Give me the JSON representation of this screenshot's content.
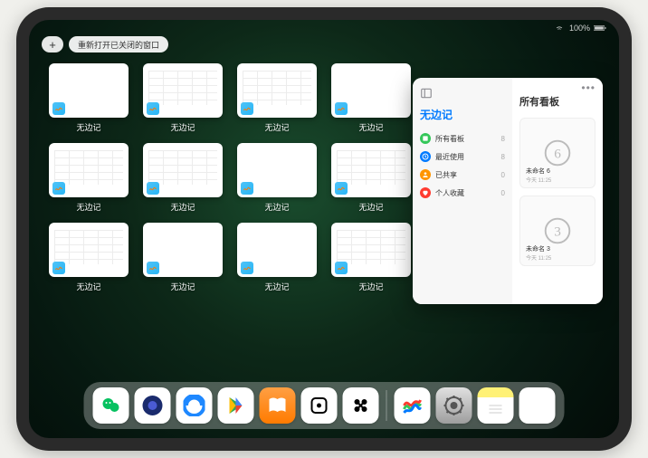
{
  "status": {
    "battery_text": "100%"
  },
  "top": {
    "plus_label": "+",
    "reopen_label": "重新打开已关闭的窗口"
  },
  "windows": [
    {
      "label": "无边记",
      "thumb": "blank"
    },
    {
      "label": "无边记",
      "thumb": "grid"
    },
    {
      "label": "无边记",
      "thumb": "grid"
    },
    {
      "label": "无边记",
      "thumb": "blank"
    },
    {
      "label": "无边记",
      "thumb": "grid"
    },
    {
      "label": "无边记",
      "thumb": "grid"
    },
    {
      "label": "无边记",
      "thumb": "blank"
    },
    {
      "label": "无边记",
      "thumb": "grid"
    },
    {
      "label": "无边记",
      "thumb": "grid"
    },
    {
      "label": "无边记",
      "thumb": "blank"
    },
    {
      "label": "无边记",
      "thumb": "blank"
    },
    {
      "label": "无边记",
      "thumb": "grid"
    }
  ],
  "expanded": {
    "sidebar_title": "无边记",
    "main_title": "所有看板",
    "items": [
      {
        "icon": "square-stack",
        "color": "#34c759",
        "label": "所有看板",
        "count": "8"
      },
      {
        "icon": "clock",
        "color": "#007aff",
        "label": "最近使用",
        "count": "8"
      },
      {
        "icon": "person",
        "color": "#ff9500",
        "label": "已共享",
        "count": "0"
      },
      {
        "icon": "heart",
        "color": "#ff3b30",
        "label": "个人收藏",
        "count": "0"
      }
    ],
    "boards": [
      {
        "name": "未命名 6",
        "time": "今天 11:25",
        "sketch": "6"
      },
      {
        "name": "未命名 3",
        "time": "今天 11:25",
        "sketch": "3"
      }
    ]
  },
  "dock": {
    "left": [
      "wechat",
      "quark",
      "qqbrowser",
      "play",
      "books",
      "dice",
      "x"
    ],
    "right": [
      "freeform",
      "settings",
      "notes",
      "app-library"
    ]
  }
}
